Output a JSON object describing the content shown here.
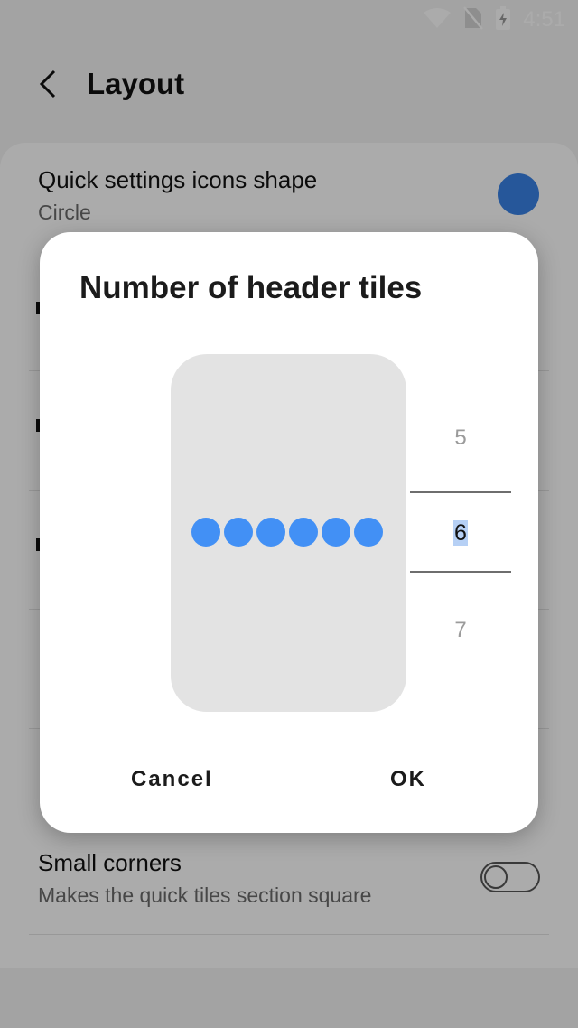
{
  "status_bar": {
    "time": "4:51",
    "icons": [
      "wifi-icon",
      "no-sim-icon",
      "battery-charging-icon"
    ]
  },
  "app_bar": {
    "back_icon": "chevron-left-icon",
    "title": "Layout"
  },
  "settings": [
    {
      "title": "Quick settings icons shape",
      "subtitle": "Circle",
      "control": "shape-preview-circle",
      "accent": "#3a82e6"
    },
    {
      "title": "Small corners",
      "subtitle": "Makes the quick tiles section square",
      "control": "toggle",
      "checked": false
    }
  ],
  "dialog": {
    "title": "Number of header tiles",
    "tile_count": 6,
    "tile_color": "#4290f5",
    "picker": {
      "prev": "5",
      "selected": "6",
      "next": "7"
    },
    "cancel_label": "Cancel",
    "ok_label": "OK"
  }
}
